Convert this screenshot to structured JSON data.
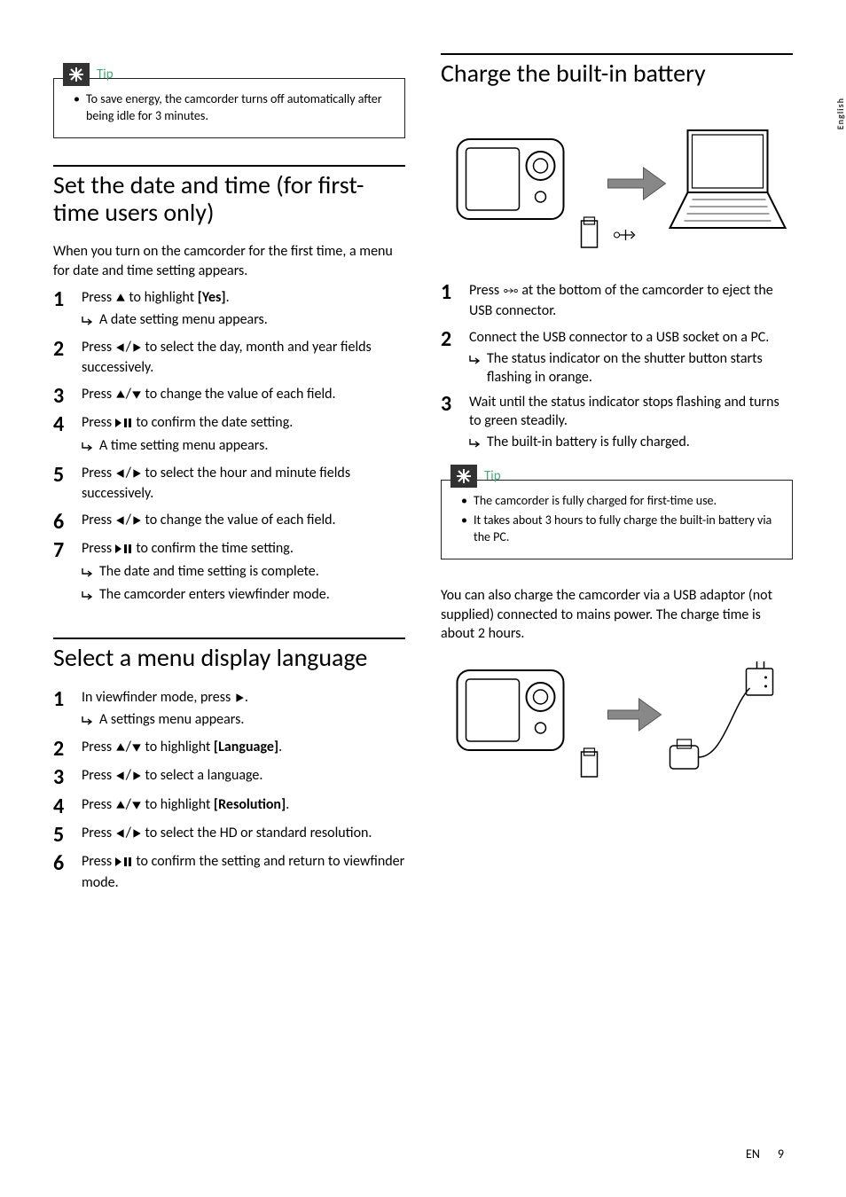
{
  "sideTab": "English",
  "footer": {
    "lang": "EN",
    "page": "9"
  },
  "left": {
    "tip1": {
      "label": "Tip",
      "items": [
        "To save energy, the camcorder turns off automatically after being idle for 3 minutes."
      ]
    },
    "sec1": {
      "title": "Set the date and time (for first-time users only)",
      "intro": "When you turn on the camcorder for the first time, a menu for date and time setting appears.",
      "steps": [
        {
          "n": "1",
          "body_a": "Press ",
          "body_b": " to highlight ",
          "ui": "[Yes]",
          "body_c": ".",
          "subs": [
            "A date setting menu appears."
          ]
        },
        {
          "n": "2",
          "body_a": "Press ",
          "body_b": " to select the day, month and year fields successively."
        },
        {
          "n": "3",
          "body_a": "Press ",
          "body_b": " to change the value of each field."
        },
        {
          "n": "4",
          "body_a": "Press ",
          "body_b": " to confirm the date setting.",
          "subs": [
            "A time setting menu appears."
          ]
        },
        {
          "n": "5",
          "body_a": "Press ",
          "body_b": " to select the hour and minute fields successively."
        },
        {
          "n": "6",
          "body_a": "Press ",
          "body_b": " to change the value of each field."
        },
        {
          "n": "7",
          "body_a": "Press ",
          "body_b": " to confirm the time setting.",
          "subs": [
            "The date and time setting is complete.",
            "The camcorder enters viewfinder mode."
          ]
        }
      ]
    },
    "sec2": {
      "title": "Select a menu display language",
      "steps": [
        {
          "n": "1",
          "body_a": "In viewfinder mode, press ",
          "body_b": ".",
          "subs": [
            "A settings menu appears."
          ]
        },
        {
          "n": "2",
          "body_a": "Press ",
          "body_b": " to highlight ",
          "ui": "[Language]",
          "body_c": "."
        },
        {
          "n": "3",
          "body_a": "Press ",
          "body_b": " to select a language."
        },
        {
          "n": "4",
          "body_a": "Press ",
          "body_b": " to highlight ",
          "ui": "[Resolution]",
          "body_c": "."
        },
        {
          "n": "5",
          "body_a": "Press ",
          "body_b": " to select the HD or standard resolution."
        },
        {
          "n": "6",
          "body_a": "Press ",
          "body_b": " to confirm the setting and return to viewfinder mode."
        }
      ]
    }
  },
  "right": {
    "sec1": {
      "title": "Charge the built-in battery",
      "steps": [
        {
          "n": "1",
          "body_a": "Press ",
          "body_b": " at the bottom of the camcorder to eject the USB connector."
        },
        {
          "n": "2",
          "body_a": "Connect the USB connector to a USB socket on a PC.",
          "subs": [
            "The status indicator on the shutter button starts flashing in orange."
          ]
        },
        {
          "n": "3",
          "body_a": "Wait until the status indicator stops flashing and turns to green steadily.",
          "subs": [
            "The built-in battery is fully charged."
          ]
        }
      ]
    },
    "tip2": {
      "label": "Tip",
      "items": [
        "The camcorder is fully charged for first-time use.",
        "It takes about 3 hours to fully charge the built-in battery via the PC."
      ]
    },
    "para": "You can also charge the camcorder via a USB adaptor (not supplied) connected to mains power. The charge time is about 2 hours."
  }
}
